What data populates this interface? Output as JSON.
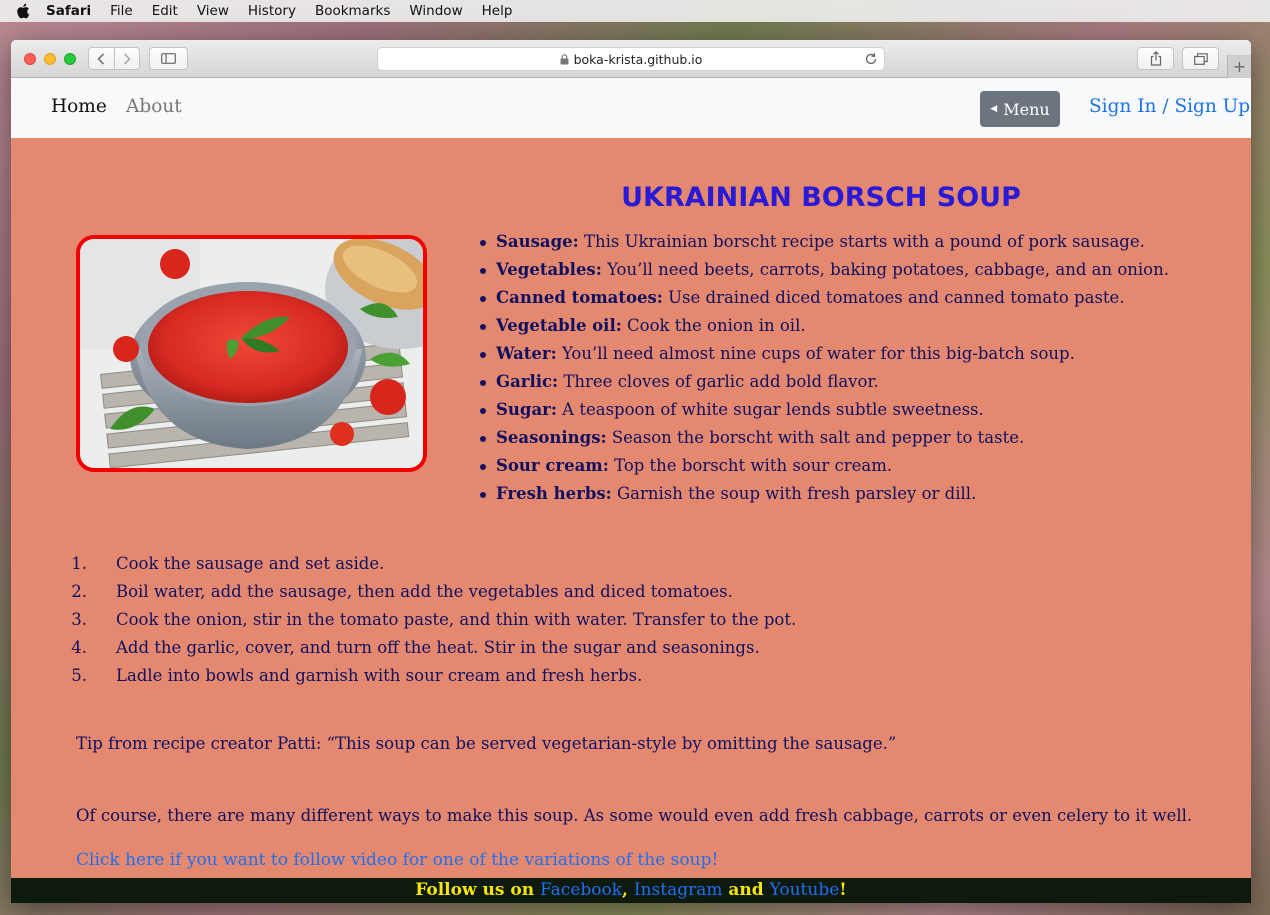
{
  "system_menubar": {
    "app_name": "Safari",
    "items": [
      "File",
      "Edit",
      "View",
      "History",
      "Bookmarks",
      "Window",
      "Help"
    ]
  },
  "browser": {
    "url": "boka-krista.github.io"
  },
  "navbar": {
    "home": "Home",
    "about": "About",
    "menu_button": "Menu",
    "signin": "Sign In / Sign Up"
  },
  "recipe": {
    "title": "UKRAINIAN BORSCH SOUP",
    "ingredients": [
      {
        "name": "Sausage:",
        "text": " This Ukrainian borscht recipe starts with a pound of pork sausage."
      },
      {
        "name": "Vegetables:",
        "text": " You’ll need beets, carrots, baking potatoes, cabbage, and an onion."
      },
      {
        "name": "Canned tomatoes:",
        "text": " Use drained diced tomatoes and canned tomato paste."
      },
      {
        "name": "Vegetable oil:",
        "text": " Cook the onion in oil."
      },
      {
        "name": "Water:",
        "text": " You’ll need almost nine cups of water for this big-batch soup."
      },
      {
        "name": "Garlic:",
        "text": " Three cloves of garlic add bold flavor."
      },
      {
        "name": "Sugar:",
        "text": " A teaspoon of white sugar lends subtle sweetness."
      },
      {
        "name": "Seasonings:",
        "text": " Season the borscht with salt and pepper to taste."
      },
      {
        "name": "Sour cream:",
        "text": " Top the borscht with sour cream."
      },
      {
        "name": "Fresh herbs:",
        "text": " Garnish the soup with fresh parsley or dill."
      }
    ],
    "steps": [
      {
        "num": "1.",
        "text": "Cook the sausage and set aside."
      },
      {
        "num": "2.",
        "text": "Boil water, add the sausage, then add the vegetables and diced tomatoes."
      },
      {
        "num": "3.",
        "text": "Cook the onion, stir in the tomato paste, and thin with water. Transfer to the pot."
      },
      {
        "num": "4.",
        "text": "Add the garlic, cover, and turn off the heat. Stir in the sugar and seasonings."
      },
      {
        "num": "5.",
        "text": "Ladle into bowls and garnish with sour cream and fresh herbs."
      }
    ],
    "tip": "Tip from recipe creator Patti: “This soup can be served vegetarian-style by omitting the sausage.”",
    "note": "Of course, there are many different ways to make this soup. As some would even add fresh cabbage, carrots or even celery to it well.",
    "video_link": "Click here if you want to follow video for one of the variations of the soup!"
  },
  "footer": {
    "prefix": "Follow us on ",
    "facebook": "Facebook",
    "sep1": ", ",
    "instagram": "Instagram",
    "sep2": " and ",
    "youtube": "Youtube",
    "suffix": "!"
  },
  "colors": {
    "content_bg": "#e4896f",
    "title": "#2a1ad6",
    "text": "#101060",
    "link": "#1e6ff2",
    "photo_border": "#f20000",
    "footer_bg": "#0f1a0e",
    "footer_text": "#f7e600",
    "menu_button": "#6c757d"
  }
}
